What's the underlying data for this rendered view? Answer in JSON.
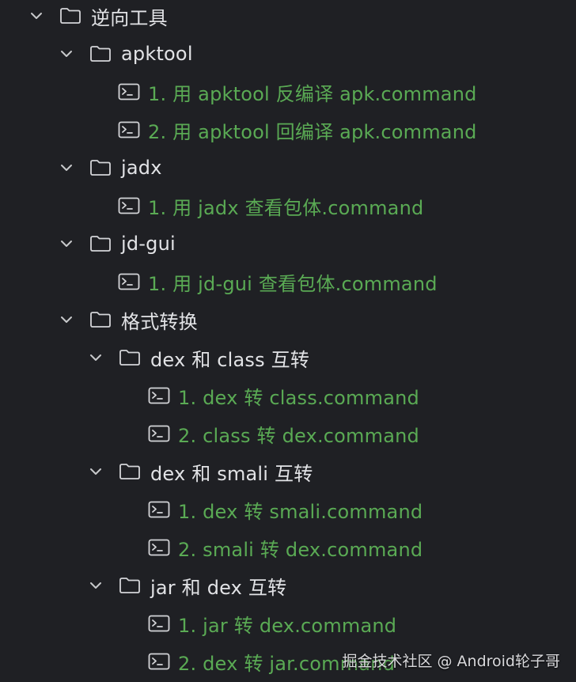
{
  "tree": {
    "root": {
      "label": "逆向工具"
    },
    "apktool": {
      "label": "apktool",
      "files": [
        "1. 用 apktool 反编译 apk.command",
        "2. 用 apktool 回编译 apk.command"
      ]
    },
    "jadx": {
      "label": "jadx",
      "files": [
        "1. 用 jadx 查看包体.command"
      ]
    },
    "jdgui": {
      "label": "jd-gui",
      "files": [
        "1. 用 jd-gui 查看包体.command"
      ]
    },
    "format": {
      "label": "格式转换",
      "dex_class": {
        "label": "dex 和 class 互转",
        "files": [
          "1. dex 转 class.command",
          "2. class 转 dex.command"
        ]
      },
      "dex_smali": {
        "label": "dex 和 smali 互转",
        "files": [
          "1. dex 转 smali.command",
          "2. smali 转 dex.command"
        ]
      },
      "jar_dex": {
        "label": "jar 和 dex 互转",
        "files": [
          "1. jar 转 dex.command",
          "2. dex 转 jar.command"
        ]
      }
    }
  },
  "watermark": "掘金技术社区 @ Android轮子哥",
  "icons": {
    "chevron": "chevron-down-icon",
    "folder": "folder-icon",
    "file": "terminal-file-icon"
  },
  "colors": {
    "background": "#1f2024",
    "folder_text": "#e2e3e6",
    "file_text": "#5aaa54",
    "icon": "#c8c9cc"
  }
}
